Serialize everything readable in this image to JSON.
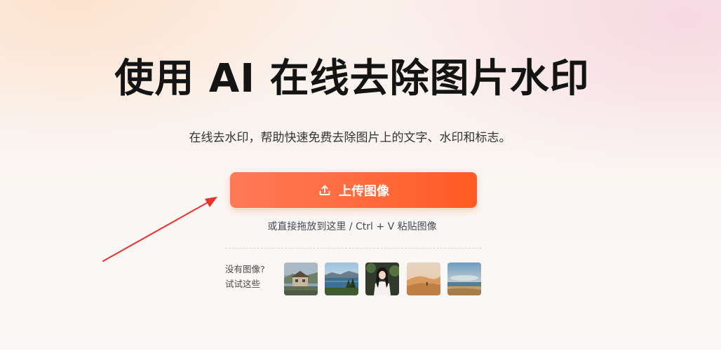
{
  "hero": {
    "title": "使用 AI 在线去除图片水印",
    "subtitle": "在线去水印，帮助快速免费去除图片上的文字、水印和标志。"
  },
  "upload": {
    "button_label": "上传图像",
    "icon": "upload-icon",
    "hint": "或直接拖放到这里 / Ctrl + V 粘贴图像"
  },
  "samples": {
    "prompt_line1": "没有图像?",
    "prompt_line2": "试试这些",
    "items": [
      {
        "name": "house-landscape-sample"
      },
      {
        "name": "lake-sample"
      },
      {
        "name": "portrait-sample"
      },
      {
        "name": "desert-sample"
      },
      {
        "name": "beach-sunset-sample"
      }
    ]
  },
  "colors": {
    "accent_start": "#ff7a57",
    "accent_end": "#ff5a22",
    "arrow": "#e8322c"
  }
}
